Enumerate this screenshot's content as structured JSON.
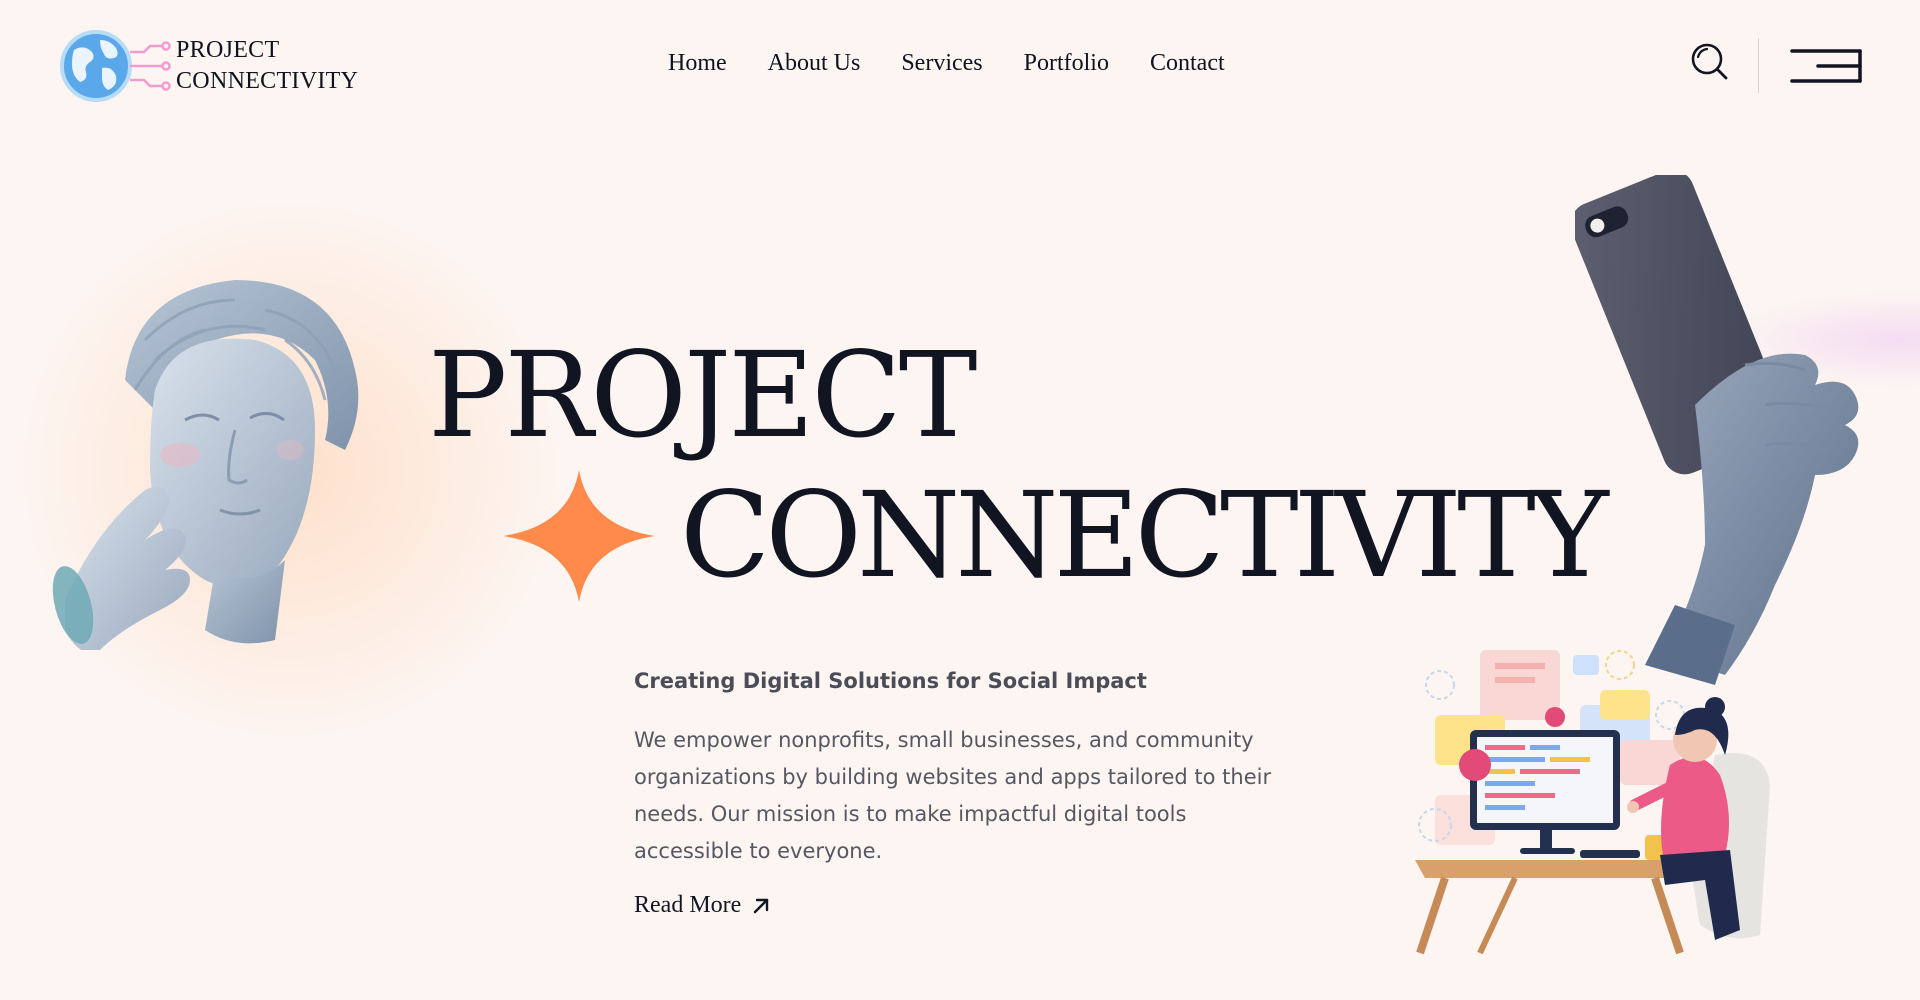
{
  "header": {
    "logo_line1": "PROJECT",
    "logo_line2": "CONNECTIVITY",
    "nav": [
      "Home",
      "About Us",
      "Services",
      "Portfolio",
      "Contact"
    ],
    "search_icon": "search-icon",
    "menu_icon": "hamburger-menu-icon"
  },
  "hero": {
    "title_line1": "PROJECT",
    "title_line2": "CONNECTIVITY",
    "tagline": "Creating Digital Solutions for Social Impact",
    "description": "We empower nonprofits, small businesses, and community organizations by building websites and apps tailored to their needs. Our mission is to make impactful digital tools accessible to everyone.",
    "read_more": "Read More",
    "read_more_icon": "arrow-up-right-icon"
  },
  "colors": {
    "background": "#fdf5f1",
    "text": "#111522",
    "accent": "#ff8a4c",
    "statue": "#b9c6d6"
  }
}
